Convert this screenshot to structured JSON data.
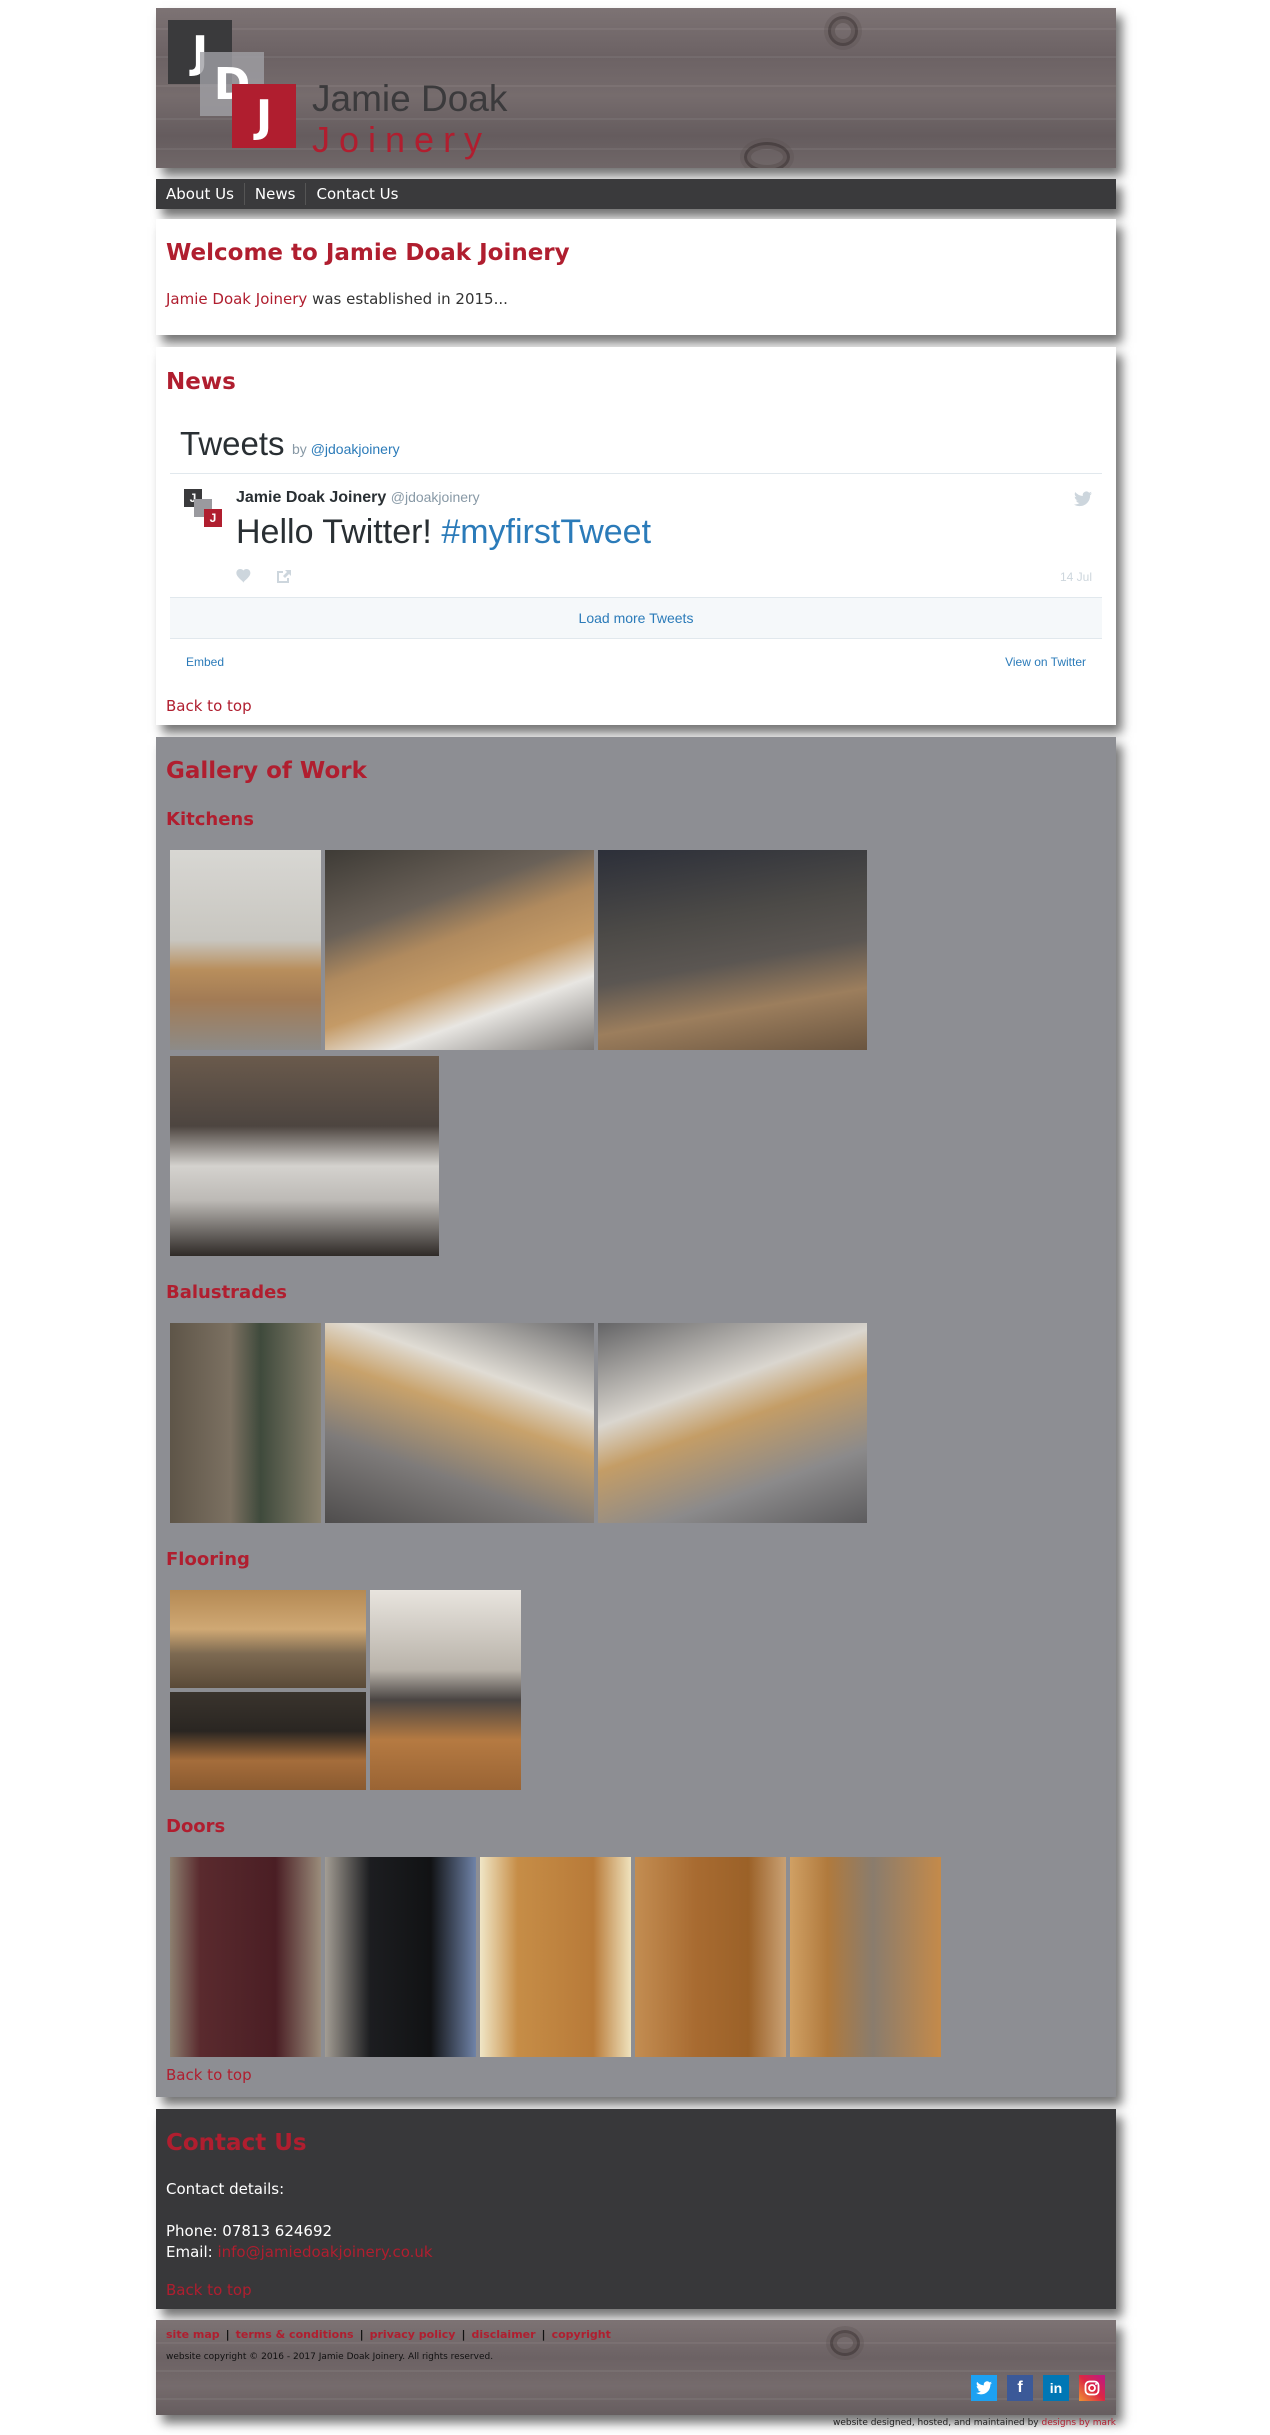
{
  "logo": {
    "letter_j": "J",
    "letter_d": "D",
    "letter_j2": "J",
    "name": "Jamie Doak",
    "sub": "Joinery"
  },
  "nav": {
    "items": [
      "About Us",
      "News",
      "Contact Us"
    ]
  },
  "welcome": {
    "title": "Welcome to Jamie Doak Joinery",
    "link": "Jamie Doak Joinery",
    "text": " was established in 2015..."
  },
  "news": {
    "title": "News",
    "widget_title": "Tweets",
    "by": "by ",
    "handle_link": "@jdoakjoinery",
    "tweet": {
      "author": "Jamie Doak Joinery",
      "handle": "@jdoakjoinery",
      "text": "Hello Twitter! ",
      "hashtag": "#myfirstTweet",
      "date": "14 Jul"
    },
    "load_more": "Load more Tweets",
    "embed": "Embed",
    "view": "View on Twitter",
    "back": "Back to top"
  },
  "gallery": {
    "title": "Gallery of Work",
    "sections": [
      "Kitchens",
      "Balustrades",
      "Flooring",
      "Doors"
    ],
    "back": "Back to top"
  },
  "contact": {
    "title": "Contact Us",
    "details": "Contact details:",
    "phone_label": "Phone: ",
    "phone": "07813 624692",
    "email_label": "Email: ",
    "email": "info@jamiedoakjoinery.co.uk",
    "back": "Back to top"
  },
  "footer": {
    "links": [
      "site map",
      "terms & conditions",
      "privacy policy",
      "disclaimer",
      "copyright"
    ],
    "copyright": "website copyright © 2016 - 2017 Jamie Doak Joinery.  All rights reserved.",
    "social": [
      "twitter-icon",
      "facebook-icon",
      "linkedin-icon",
      "instagram-icon"
    ],
    "credit": "website designed, hosted, and maintained by ",
    "credit_link": "designs by mark"
  },
  "colors": {
    "brand_red": "#b01e2f",
    "dark": "#3a3a3c",
    "gallery_bg": "#8d8e93",
    "twitter_blue": "#2b7bb9"
  }
}
